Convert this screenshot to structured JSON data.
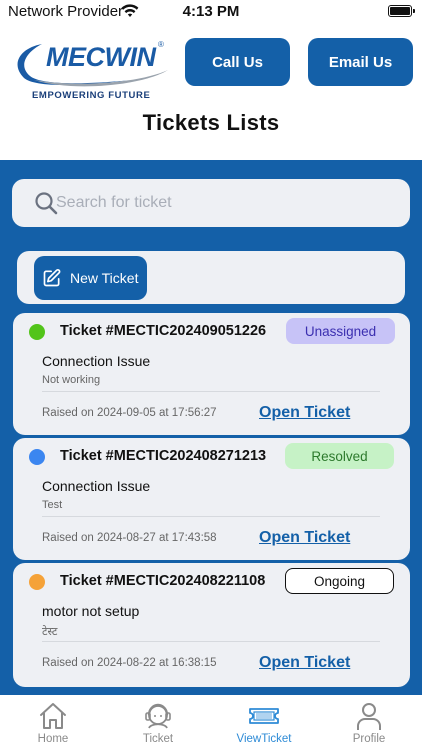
{
  "status_bar": {
    "carrier": "Network Provider",
    "time": "4:13 PM"
  },
  "header": {
    "logo_text": "MECWIN",
    "logo_reg": "®",
    "logo_tagline": "EMPOWERING FUTURE",
    "call_label": "Call Us",
    "email_label": "Email Us",
    "title": "Tickets Lists"
  },
  "search": {
    "placeholder": "Search for ticket",
    "value": ""
  },
  "new_ticket": {
    "label": "New Ticket"
  },
  "tickets": [
    {
      "id": "Ticket #MECTIC202409051226",
      "status": "Unassigned",
      "subject": "Connection Issue",
      "description": "Not working",
      "raised": "Raised on 2024-09-05 at 17:56:27",
      "open_label": "Open Ticket",
      "dot_color": "#52c41a"
    },
    {
      "id": "Ticket #MECTIC202408271213",
      "status": "Resolved",
      "subject": "Connection Issue",
      "description": "Test",
      "raised": "Raised on 2024-08-27 at 17:43:58",
      "open_label": "Open Ticket",
      "dot_color": "#3b86f0"
    },
    {
      "id": "Ticket #MECTIC202408221108",
      "status": "Ongoing",
      "subject": "motor not setup",
      "description": "टेस्ट",
      "raised": "Raised on 2024-08-22 at 16:38:15",
      "open_label": "Open Ticket",
      "dot_color": "#f5a238"
    }
  ],
  "tab_bar": {
    "tabs": [
      {
        "label": "Home",
        "icon": "home-icon"
      },
      {
        "label": "Ticket",
        "icon": "support-agent-icon"
      },
      {
        "label": "ViewTicket",
        "icon": "ticket-icon",
        "active": true
      },
      {
        "label": "Profile",
        "icon": "profile-icon"
      }
    ]
  },
  "colors": {
    "brand_blue": "#1460a8",
    "card_bg": "#eef0f4",
    "active_tab": "#2e8bd6",
    "unassigned_badge": "#c7c3f7",
    "resolved_badge": "#c6f2c6"
  }
}
